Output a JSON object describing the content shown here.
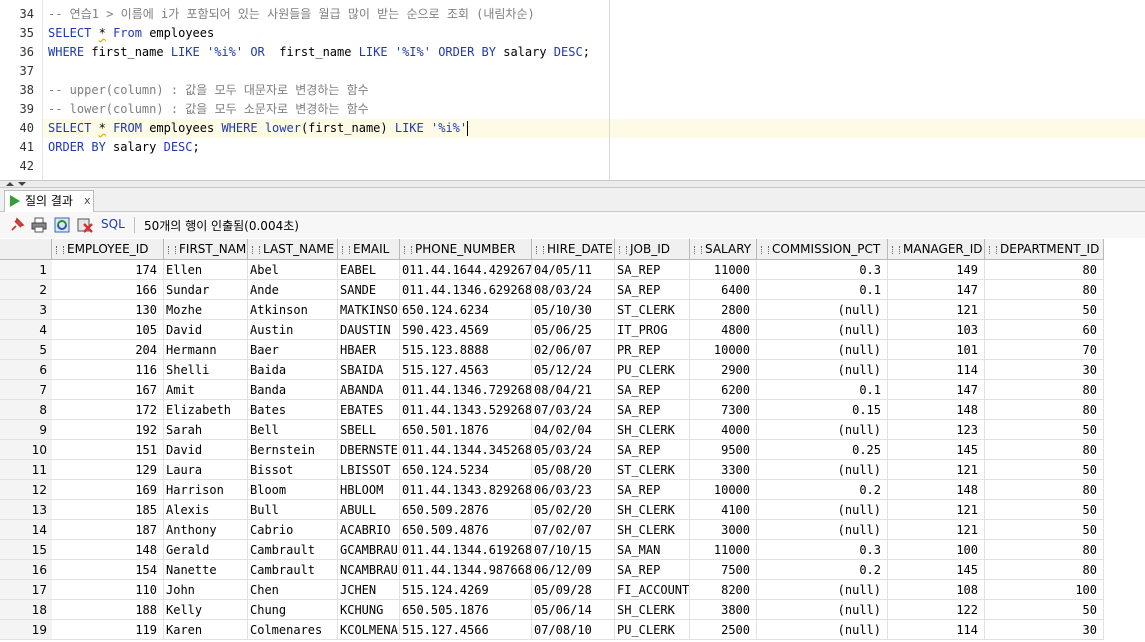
{
  "editor": {
    "lines": [
      {
        "num": "34",
        "segments": [
          {
            "t": "-- 연습1 > 이름에 i가 포함되어 있는 사원들을 월급 많이 받는 순으로 조회 (내림차순)",
            "c": "cm"
          }
        ]
      },
      {
        "num": "35",
        "segments": [
          {
            "t": "SELECT",
            "c": "kw"
          },
          {
            "t": " ",
            "c": ""
          },
          {
            "t": "*",
            "c": "sq"
          },
          {
            "t": " ",
            "c": ""
          },
          {
            "t": "From",
            "c": "kw"
          },
          {
            "t": " employees",
            "c": ""
          }
        ]
      },
      {
        "num": "36",
        "segments": [
          {
            "t": "WHERE",
            "c": "kw"
          },
          {
            "t": " first_name ",
            "c": ""
          },
          {
            "t": "LIKE",
            "c": "kw"
          },
          {
            "t": " ",
            "c": ""
          },
          {
            "t": "'%i%'",
            "c": "str"
          },
          {
            "t": " ",
            "c": ""
          },
          {
            "t": "OR",
            "c": "kw"
          },
          {
            "t": "  first_name ",
            "c": ""
          },
          {
            "t": "LIKE",
            "c": "kw"
          },
          {
            "t": " ",
            "c": ""
          },
          {
            "t": "'%I%'",
            "c": "str"
          },
          {
            "t": " ",
            "c": ""
          },
          {
            "t": "ORDER BY",
            "c": "kw"
          },
          {
            "t": " salary ",
            "c": ""
          },
          {
            "t": "DESC",
            "c": "kw"
          },
          {
            "t": ";",
            "c": ""
          }
        ]
      },
      {
        "num": "37",
        "segments": []
      },
      {
        "num": "38",
        "segments": [
          {
            "t": "-- upper(column) : 값을 모두 대문자로 변경하는 함수",
            "c": "cm"
          }
        ]
      },
      {
        "num": "39",
        "segments": [
          {
            "t": "-- lower(column) : 값을 모두 소문자로 변경하는 함수",
            "c": "cm"
          }
        ]
      },
      {
        "num": "40",
        "segments": [
          {
            "t": "SELECT",
            "c": "kw"
          },
          {
            "t": " ",
            "c": ""
          },
          {
            "t": "*",
            "c": "sq"
          },
          {
            "t": " ",
            "c": ""
          },
          {
            "t": "FROM",
            "c": "kw"
          },
          {
            "t": " employees ",
            "c": ""
          },
          {
            "t": "WHERE",
            "c": "kw"
          },
          {
            "t": " ",
            "c": ""
          },
          {
            "t": "lower",
            "c": "kw"
          },
          {
            "t": "(first_name) ",
            "c": ""
          },
          {
            "t": "LIKE",
            "c": "kw"
          },
          {
            "t": " ",
            "c": ""
          },
          {
            "t": "'%i%'",
            "c": "str"
          }
        ]
      },
      {
        "num": "41",
        "segments": [
          {
            "t": "ORDER BY",
            "c": "kw"
          },
          {
            "t": " salary ",
            "c": ""
          },
          {
            "t": "DESC",
            "c": "kw"
          },
          {
            "t": ";",
            "c": ""
          }
        ]
      },
      {
        "num": "42",
        "segments": []
      }
    ]
  },
  "results": {
    "tab_label": "질의 결과",
    "tab_close": "x",
    "sql_label": "SQL",
    "status": "50개의 행이 인출됨(0.004초)",
    "columns": [
      "EMPLOYEE_ID",
      "FIRST_NAME",
      "LAST_NAME",
      "EMAIL",
      "PHONE_NUMBER",
      "HIRE_DATE",
      "JOB_ID",
      "SALARY",
      "COMMISSION_PCT",
      "MANAGER_ID",
      "DEPARTMENT_ID"
    ],
    "rows": [
      [
        "1",
        "174",
        "Ellen",
        "Abel",
        "EABEL",
        "011.44.1644.429267",
        "04/05/11",
        "SA_REP",
        "11000",
        "0.3",
        "149",
        "80"
      ],
      [
        "2",
        "166",
        "Sundar",
        "Ande",
        "SANDE",
        "011.44.1346.629268",
        "08/03/24",
        "SA_REP",
        "6400",
        "0.1",
        "147",
        "80"
      ],
      [
        "3",
        "130",
        "Mozhe",
        "Atkinson",
        "MATKINSO",
        "650.124.6234",
        "05/10/30",
        "ST_CLERK",
        "2800",
        "(null)",
        "121",
        "50"
      ],
      [
        "4",
        "105",
        "David",
        "Austin",
        "DAUSTIN",
        "590.423.4569",
        "05/06/25",
        "IT_PROG",
        "4800",
        "(null)",
        "103",
        "60"
      ],
      [
        "5",
        "204",
        "Hermann",
        "Baer",
        "HBAER",
        "515.123.8888",
        "02/06/07",
        "PR_REP",
        "10000",
        "(null)",
        "101",
        "70"
      ],
      [
        "6",
        "116",
        "Shelli",
        "Baida",
        "SBAIDA",
        "515.127.4563",
        "05/12/24",
        "PU_CLERK",
        "2900",
        "(null)",
        "114",
        "30"
      ],
      [
        "7",
        "167",
        "Amit",
        "Banda",
        "ABANDA",
        "011.44.1346.729268",
        "08/04/21",
        "SA_REP",
        "6200",
        "0.1",
        "147",
        "80"
      ],
      [
        "8",
        "172",
        "Elizabeth",
        "Bates",
        "EBATES",
        "011.44.1343.529268",
        "07/03/24",
        "SA_REP",
        "7300",
        "0.15",
        "148",
        "80"
      ],
      [
        "9",
        "192",
        "Sarah",
        "Bell",
        "SBELL",
        "650.501.1876",
        "04/02/04",
        "SH_CLERK",
        "4000",
        "(null)",
        "123",
        "50"
      ],
      [
        "10",
        "151",
        "David",
        "Bernstein",
        "DBERNSTE",
        "011.44.1344.345268",
        "05/03/24",
        "SA_REP",
        "9500",
        "0.25",
        "145",
        "80"
      ],
      [
        "11",
        "129",
        "Laura",
        "Bissot",
        "LBISSOT",
        "650.124.5234",
        "05/08/20",
        "ST_CLERK",
        "3300",
        "(null)",
        "121",
        "50"
      ],
      [
        "12",
        "169",
        "Harrison",
        "Bloom",
        "HBLOOM",
        "011.44.1343.829268",
        "06/03/23",
        "SA_REP",
        "10000",
        "0.2",
        "148",
        "80"
      ],
      [
        "13",
        "185",
        "Alexis",
        "Bull",
        "ABULL",
        "650.509.2876",
        "05/02/20",
        "SH_CLERK",
        "4100",
        "(null)",
        "121",
        "50"
      ],
      [
        "14",
        "187",
        "Anthony",
        "Cabrio",
        "ACABRIO",
        "650.509.4876",
        "07/02/07",
        "SH_CLERK",
        "3000",
        "(null)",
        "121",
        "50"
      ],
      [
        "15",
        "148",
        "Gerald",
        "Cambrault",
        "GCAMBRAU",
        "011.44.1344.619268",
        "07/10/15",
        "SA_MAN",
        "11000",
        "0.3",
        "100",
        "80"
      ],
      [
        "16",
        "154",
        "Nanette",
        "Cambrault",
        "NCAMBRAU",
        "011.44.1344.987668",
        "06/12/09",
        "SA_REP",
        "7500",
        "0.2",
        "145",
        "80"
      ],
      [
        "17",
        "110",
        "John",
        "Chen",
        "JCHEN",
        "515.124.4269",
        "05/09/28",
        "FI_ACCOUNT",
        "8200",
        "(null)",
        "108",
        "100"
      ],
      [
        "18",
        "188",
        "Kelly",
        "Chung",
        "KCHUNG",
        "650.505.1876",
        "05/06/14",
        "SH_CLERK",
        "3800",
        "(null)",
        "122",
        "50"
      ],
      [
        "19",
        "119",
        "Karen",
        "Colmenares",
        "KCOLMENA",
        "515.127.4566",
        "07/08/10",
        "PU_CLERK",
        "2500",
        "(null)",
        "114",
        "30"
      ]
    ]
  }
}
